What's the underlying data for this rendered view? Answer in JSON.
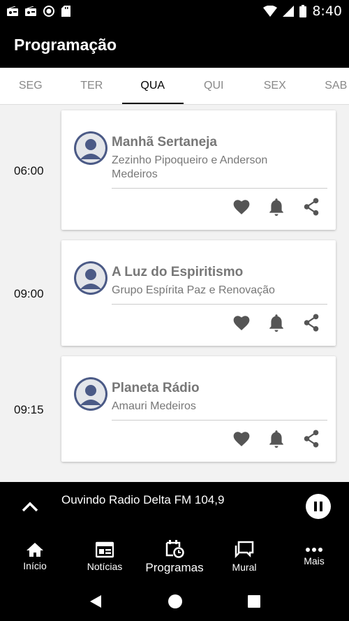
{
  "status_bar": {
    "time": "8:40"
  },
  "appbar": {
    "title": "Programação"
  },
  "tabs": [
    {
      "label": "SEG",
      "active": false
    },
    {
      "label": "TER",
      "active": false
    },
    {
      "label": "QUA",
      "active": true
    },
    {
      "label": "QUI",
      "active": false
    },
    {
      "label": "SEX",
      "active": false
    },
    {
      "label": "SAB",
      "active": false
    }
  ],
  "schedule": [
    {
      "time": "06:00",
      "title": "Manhã Sertaneja",
      "host": "Zezinho Pipoqueiro e Anderson Medeiros"
    },
    {
      "time": "09:00",
      "title": "A Luz do Espiritismo",
      "host": "Grupo Espírita Paz e Renovação"
    },
    {
      "time": "09:15",
      "title": "Planeta Rádio",
      "host": "Amauri Medeiros"
    }
  ],
  "player": {
    "now_playing": "Ouvindo Radio Delta FM 104,9"
  },
  "bottom_nav": [
    {
      "label": "Início",
      "icon": "home-icon"
    },
    {
      "label": "Notícias",
      "icon": "news-icon"
    },
    {
      "label": "Programas",
      "icon": "schedule-icon"
    },
    {
      "label": "Mural",
      "icon": "chat-icon"
    },
    {
      "label": "Mais",
      "icon": "more-icon"
    }
  ],
  "colors": {
    "bar": "#000000",
    "background": "#f2f2f2",
    "avatar": "#4b5a86",
    "muted_text": "#777777"
  }
}
